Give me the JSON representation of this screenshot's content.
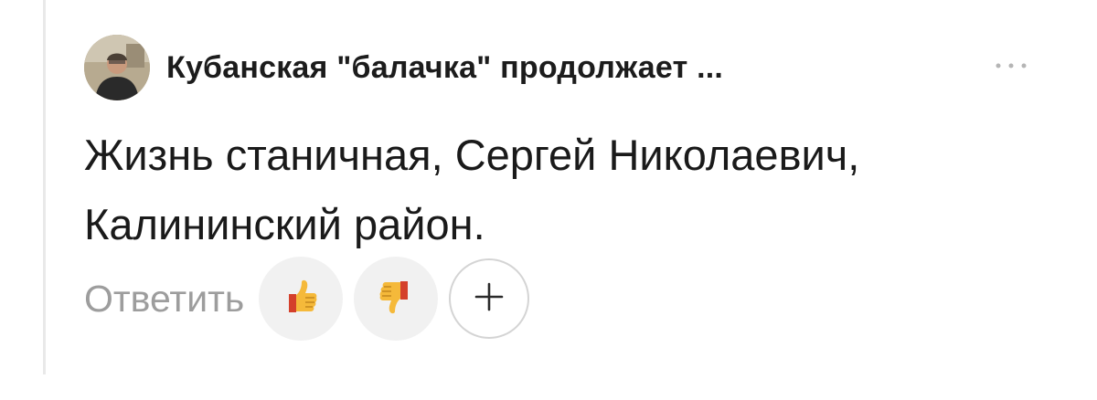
{
  "comment": {
    "author_title": "Кубанская \"балачка\" продолжает ...",
    "text_line1": "Жизнь станичная, Сергей Николаевич,",
    "text_line2": "Калининский район.",
    "reply_label": "Ответить"
  },
  "icons": {
    "more": "more-dots-icon",
    "like": "thumbs-up-icon",
    "dislike": "thumbs-down-icon",
    "add_reaction": "plus-icon"
  },
  "colors": {
    "text": "#1a1a1a",
    "muted": "#9d9d9d",
    "reaction_bg": "#f1f1f1",
    "emoji_yellow": "#f5b93a",
    "emoji_red": "#d4402b"
  }
}
